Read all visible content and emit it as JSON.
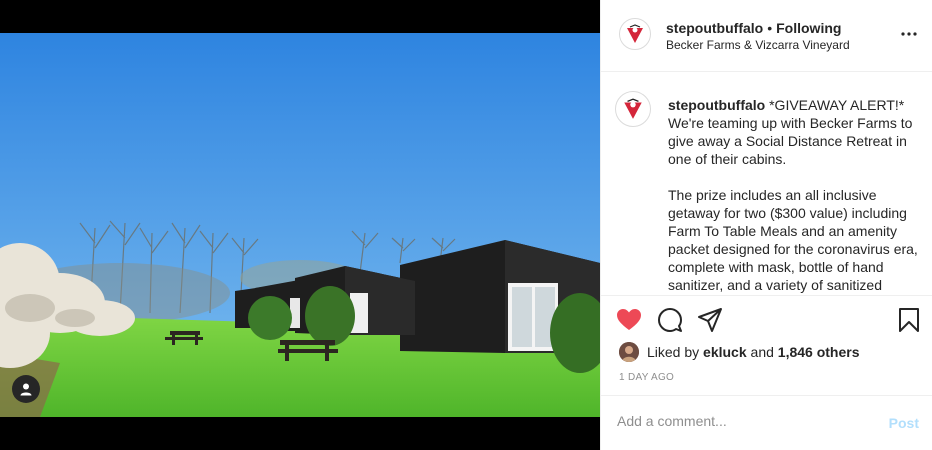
{
  "header": {
    "username": "stepoutbuffalo",
    "separator": "•",
    "follow_status": "Following",
    "location": "Becker Farms & Vizcarra Vineyard",
    "more_icon": "ellipsis-icon"
  },
  "caption": {
    "username": "stepoutbuffalo",
    "paragraph1": "*GIVEAWAY ALERT!* We're teaming up with Becker Farms to give away a Social Distance Retreat in one of their cabins.",
    "paragraph2": "The prize includes an all inclusive getaway for two ($300 value) including Farm To Table Meals and an amenity packet designed for the coronavirus era, complete with mask, bottle of hand sanitizer, and a variety of sanitized"
  },
  "actions": {
    "like_icon": "heart-filled-icon",
    "comment_icon": "comment-icon",
    "share_icon": "share-icon",
    "save_icon": "bookmark-icon",
    "like_color": "#ed4956"
  },
  "likes": {
    "prefix": "Liked by",
    "user": "ekluck",
    "and": "and",
    "others": "1,846 others"
  },
  "timestamp": "1 DAY AGO",
  "comment_box": {
    "placeholder": "Add a comment...",
    "post_label": "Post"
  },
  "colors": {
    "sky": "#3d8fe6",
    "grass": "#6fcf3a",
    "cabin": "#1e1e1e",
    "post_disabled": "#b2dffc"
  }
}
